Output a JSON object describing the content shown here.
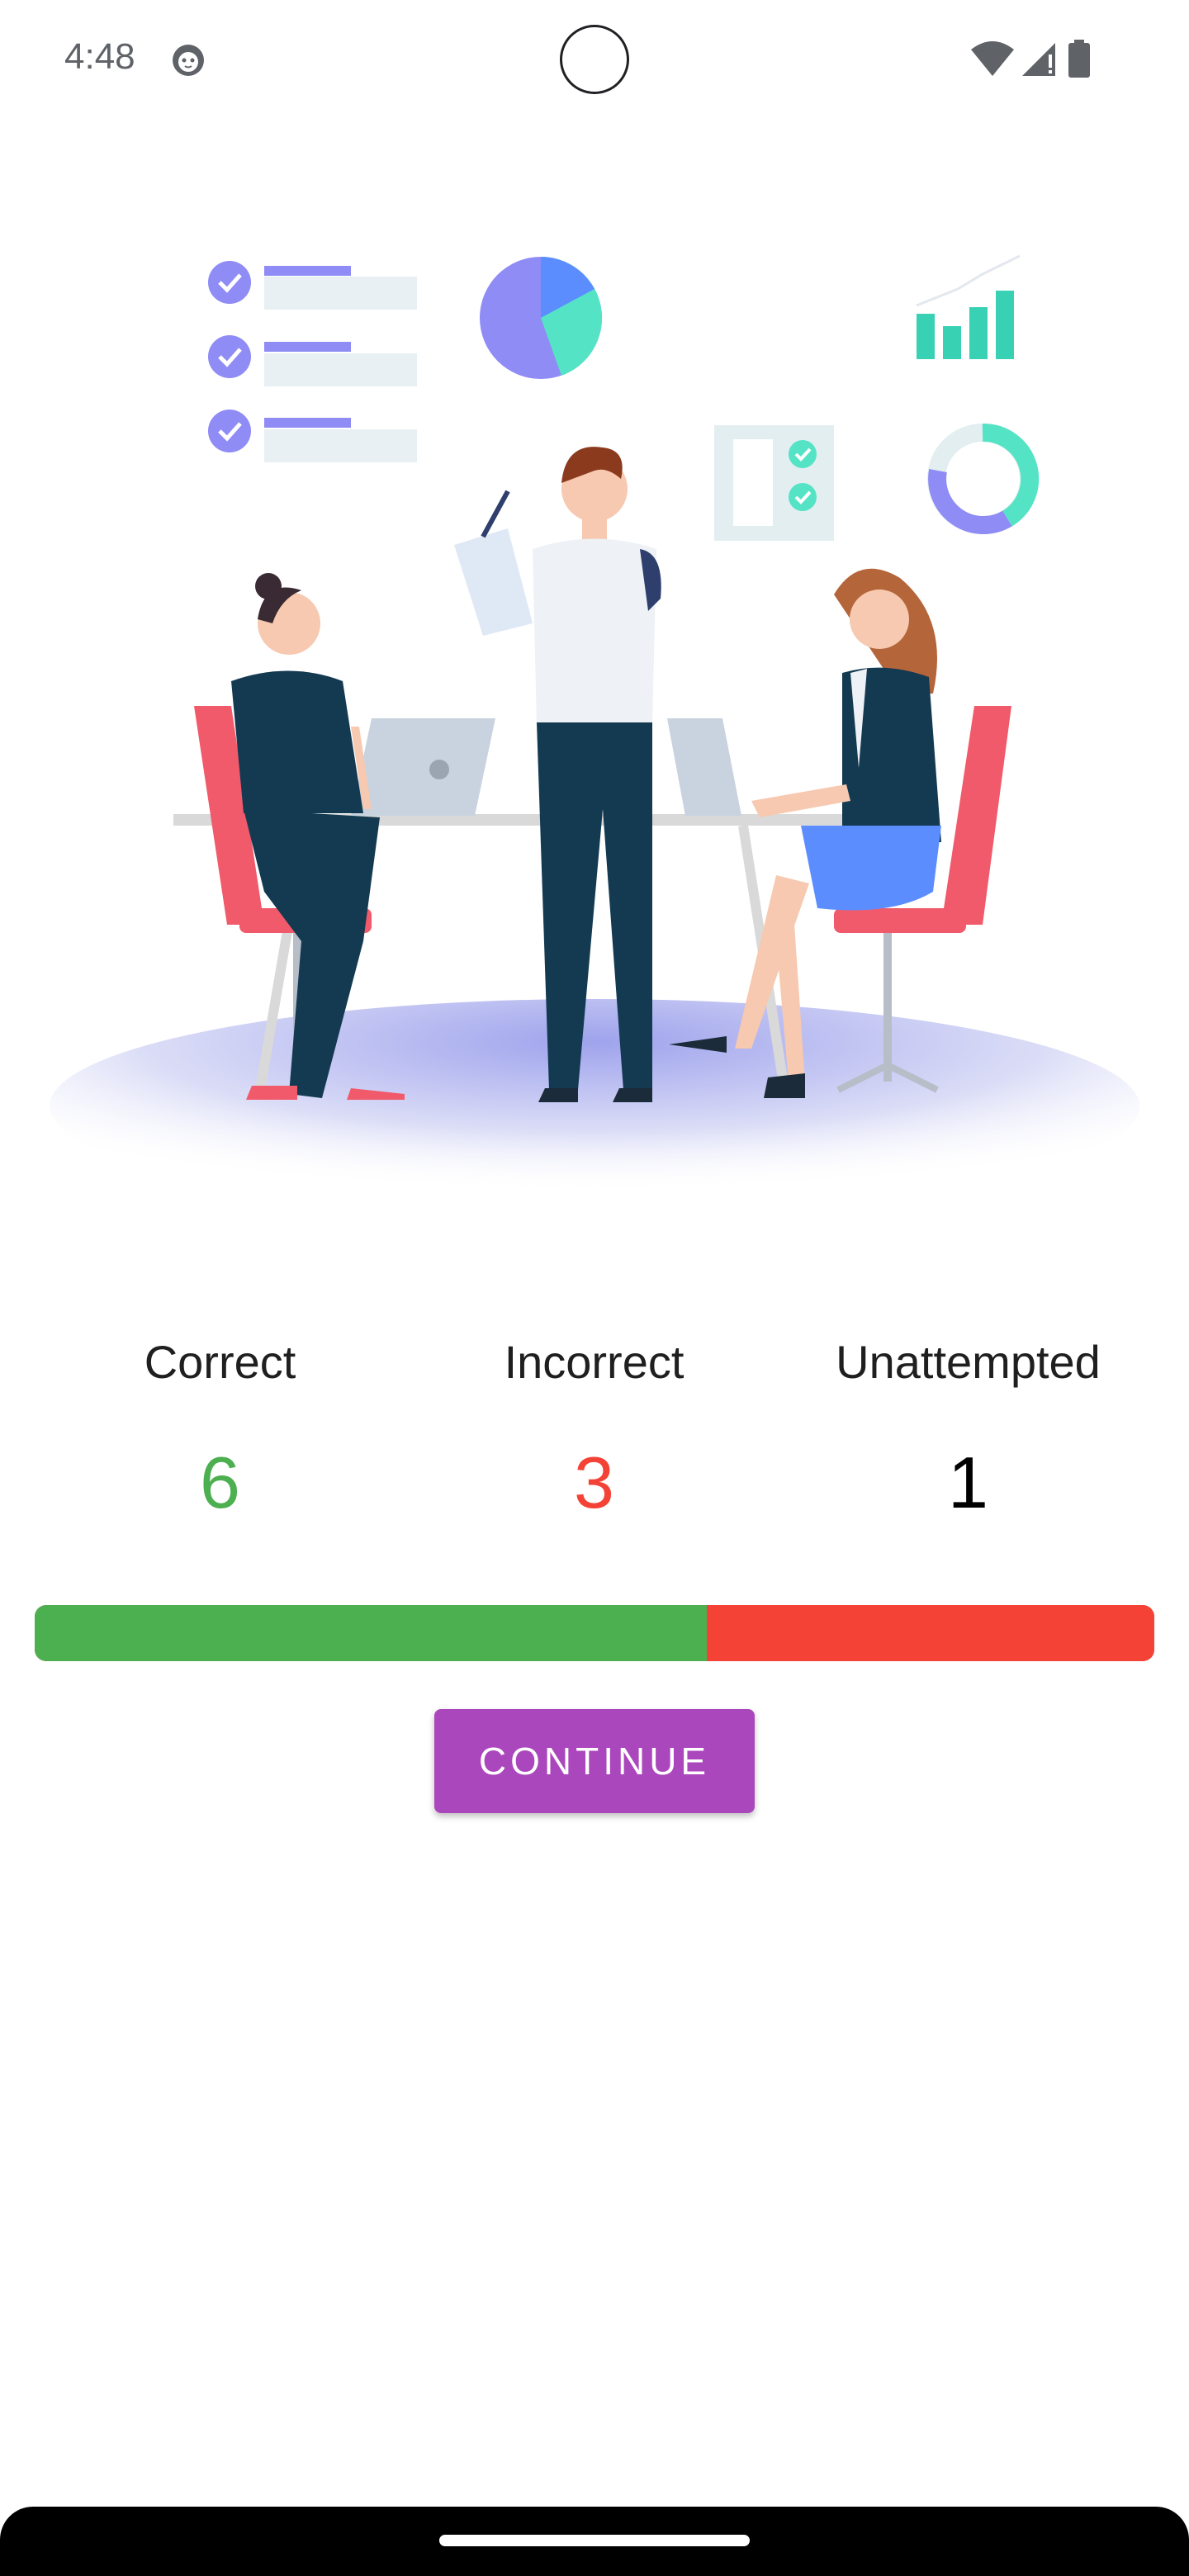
{
  "status_bar": {
    "time": "4:48",
    "app_icon": "cat-face-icon",
    "icons": [
      "wifi-icon",
      "signal-icon",
      "battery-icon"
    ]
  },
  "illustration": {
    "icon": "team-meeting-illustration"
  },
  "results": {
    "correct": {
      "label": "Correct",
      "value": "6",
      "color": "#4caf50"
    },
    "incorrect": {
      "label": "Incorrect",
      "value": "3",
      "color": "#f44336"
    },
    "unattempted": {
      "label": "Unattempted",
      "value": "1",
      "color": "#000000"
    }
  },
  "progress": {
    "correct_fraction": 0.6,
    "incorrect_fraction": 0.3,
    "unattempted_fraction": 0.1
  },
  "continue_button": {
    "label": "CONTINUE",
    "color": "#ab47bc"
  }
}
